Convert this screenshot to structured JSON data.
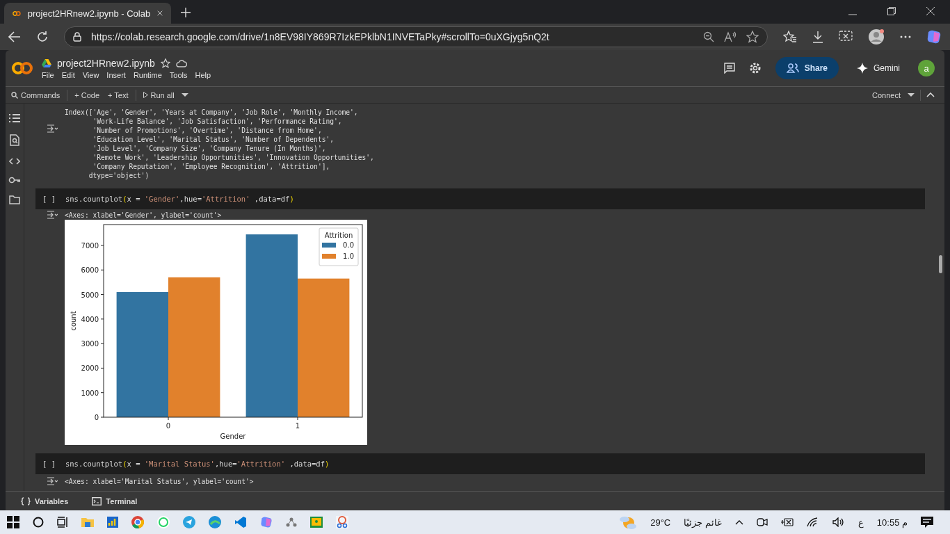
{
  "browser": {
    "tab_title": "project2HRnew2.ipynb - Colab",
    "url": "https://colab.research.google.com/drive/1n8EV98IY869R7IzkEPklbN1INVETaPky#scrollTo=0uXGjyg5nQ2t"
  },
  "colab": {
    "notebook_title": "project2HRnew2.ipynb",
    "menu": [
      "File",
      "Edit",
      "View",
      "Insert",
      "Runtime",
      "Tools",
      "Help"
    ],
    "share": "Share",
    "gemini": "Gemini",
    "avatar": "a"
  },
  "toolbar": {
    "commands": "Commands",
    "code": "+ Code",
    "text": "+ Text",
    "run_all": "Run all",
    "connect": "Connect"
  },
  "cells": [
    {
      "kind": "output_text",
      "lines": [
        "Index(['Age', 'Gender', 'Years at Company', 'Job Role', 'Monthly Income',",
        "       'Work-Life Balance', 'Job Satisfaction', 'Performance Rating',",
        "       'Number of Promotions', 'Overtime', 'Distance from Home',",
        "       'Education Level', 'Marital Status', 'Number of Dependents',",
        "       'Job Level', 'Company Size', 'Company Tenure (In Months)',",
        "       'Remote Work', 'Leadership Opportunities', 'Innovation Opportunities',",
        "       'Company Reputation', 'Employee Recognition', 'Attrition'],",
        "      dtype='object')"
      ]
    },
    {
      "kind": "code",
      "run_marker": "[ ]",
      "tokens": [
        {
          "text": "sns.countplot",
          "kind": "plain"
        },
        {
          "text": "(",
          "kind": "paren"
        },
        {
          "text": "x = ",
          "kind": "plain"
        },
        {
          "text": "'Gender'",
          "kind": "string"
        },
        {
          "text": ",hue=",
          "kind": "plain"
        },
        {
          "text": "'Attrition'",
          "kind": "string"
        },
        {
          "text": " ,data=df",
          "kind": "plain"
        },
        {
          "text": ")",
          "kind": "paren"
        }
      ]
    },
    {
      "kind": "output_chart",
      "text": "<Axes: xlabel='Gender', ylabel='count'>",
      "chart_data": {
        "type": "bar",
        "xlabel": "Gender",
        "ylabel": "count",
        "categories": [
          "0",
          "1"
        ],
        "series": [
          {
            "name": "0.0",
            "color": "#3274a1",
            "values": [
              5100,
              7450
            ]
          },
          {
            "name": "1.0",
            "color": "#e1812c",
            "values": [
              5700,
              5650
            ]
          }
        ],
        "ylim": [
          0,
          7850
        ],
        "yticks": [
          0,
          1000,
          2000,
          3000,
          4000,
          5000,
          6000,
          7000
        ],
        "legend": {
          "title": "Attrition"
        }
      }
    },
    {
      "kind": "code",
      "run_marker": "[ ]",
      "tokens": [
        {
          "text": "sns.countplot",
          "kind": "plain"
        },
        {
          "text": "(",
          "kind": "paren"
        },
        {
          "text": "x = ",
          "kind": "plain"
        },
        {
          "text": "'Marital Status'",
          "kind": "string"
        },
        {
          "text": ",hue=",
          "kind": "plain"
        },
        {
          "text": "'Attrition'",
          "kind": "string"
        },
        {
          "text": " ,data=df",
          "kind": "plain"
        },
        {
          "text": ")",
          "kind": "paren"
        }
      ]
    },
    {
      "kind": "output_cut",
      "text": "<Axes: xlabel='Marital Status', ylabel='count'>"
    }
  ],
  "bottom_bar": {
    "variables": "Variables",
    "terminal": "Terminal"
  },
  "taskbar": {
    "weather": "29°C",
    "weather_text": "غائم جزئيًا",
    "lang": "ع",
    "time": "10:55 م"
  }
}
